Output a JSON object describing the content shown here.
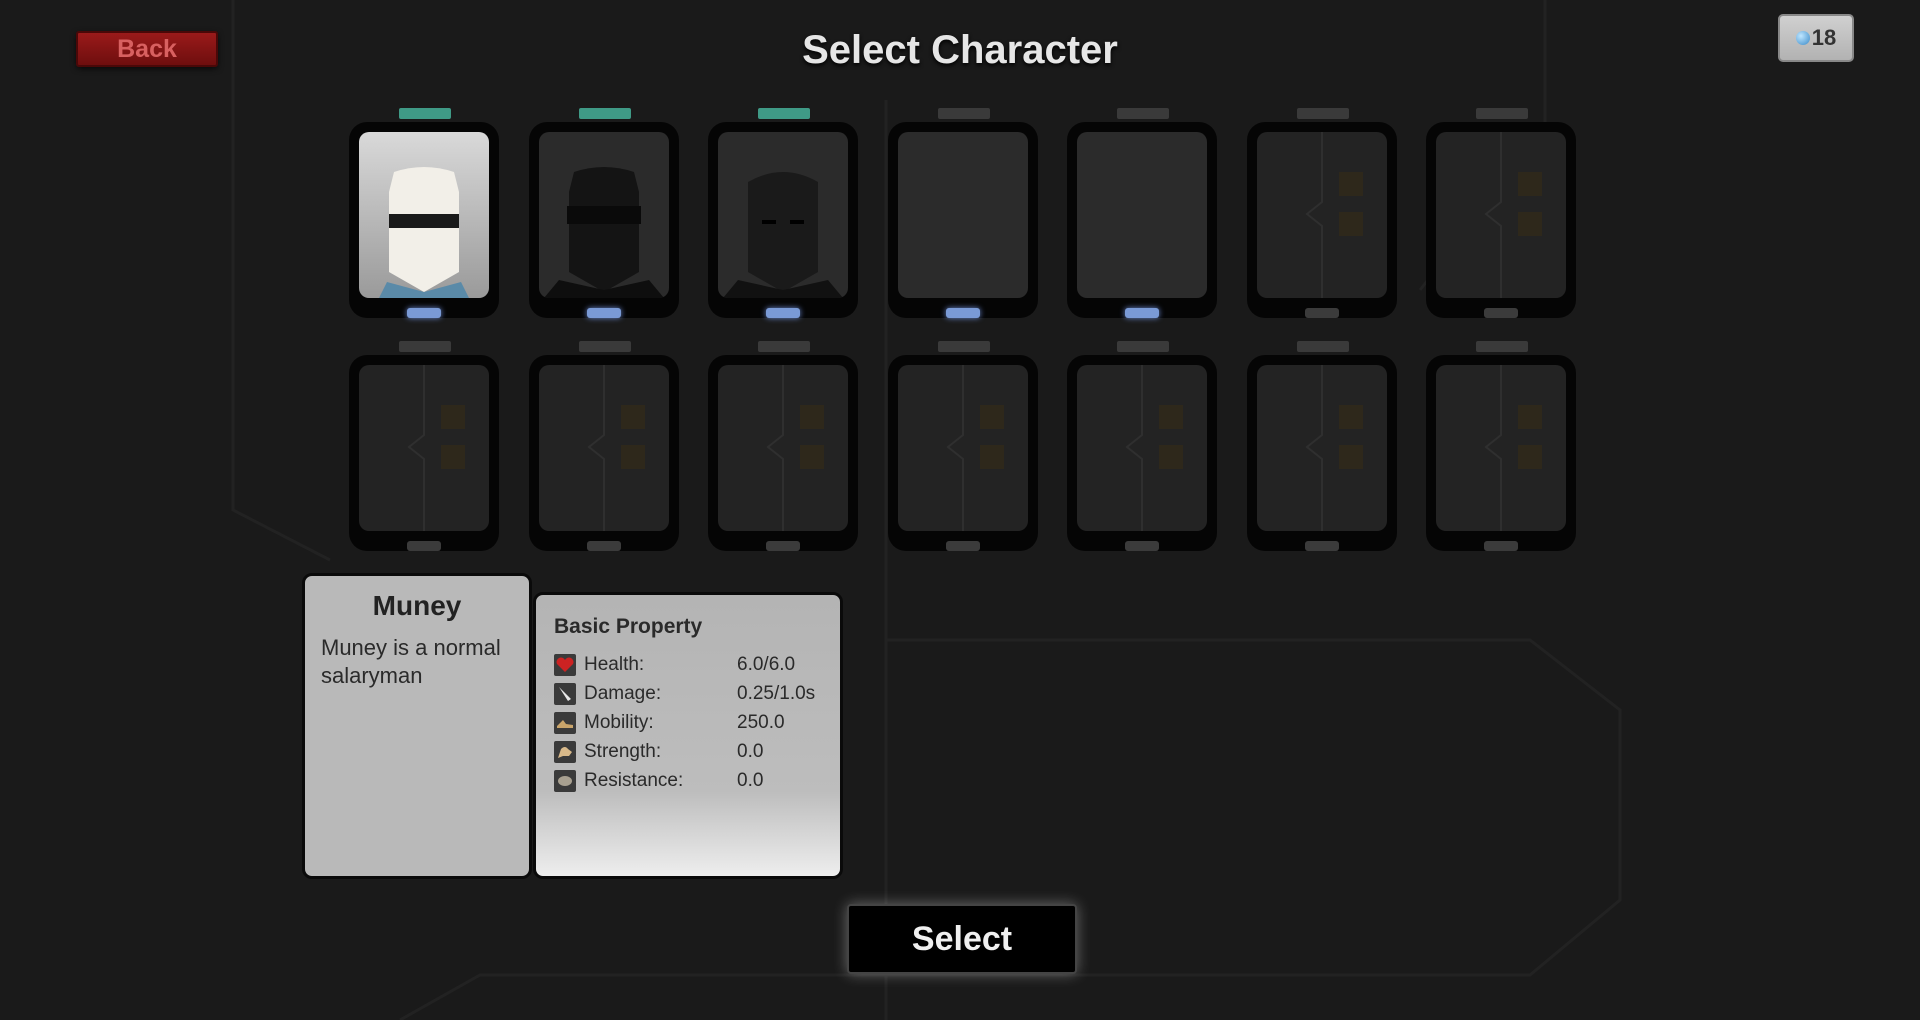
{
  "header": {
    "back_label": "Back",
    "title": "Select Character",
    "currency_value": "18",
    "currency_icon": "gem-icon"
  },
  "slots": [
    {
      "state": "selected",
      "unlocked": true,
      "active": true,
      "portrait": "light"
    },
    {
      "state": "owned",
      "unlocked": true,
      "active": true,
      "portrait": "dark-cap"
    },
    {
      "state": "owned",
      "unlocked": true,
      "active": true,
      "portrait": "dark-bald"
    },
    {
      "state": "empty",
      "unlocked": false,
      "active": true,
      "portrait": "none"
    },
    {
      "state": "empty",
      "unlocked": false,
      "active": true,
      "portrait": "none"
    },
    {
      "state": "locked",
      "unlocked": false,
      "active": false,
      "portrait": "none"
    },
    {
      "state": "locked",
      "unlocked": false,
      "active": false,
      "portrait": "none"
    },
    {
      "state": "locked",
      "unlocked": false,
      "active": false,
      "portrait": "none"
    },
    {
      "state": "locked",
      "unlocked": false,
      "active": false,
      "portrait": "none"
    },
    {
      "state": "locked",
      "unlocked": false,
      "active": false,
      "portrait": "none"
    },
    {
      "state": "locked",
      "unlocked": false,
      "active": false,
      "portrait": "none"
    },
    {
      "state": "locked",
      "unlocked": false,
      "active": false,
      "portrait": "none"
    },
    {
      "state": "locked",
      "unlocked": false,
      "active": false,
      "portrait": "none"
    },
    {
      "state": "locked",
      "unlocked": false,
      "active": false,
      "portrait": "none"
    }
  ],
  "character": {
    "name": "Muney",
    "description": "Muney is a normal salaryman"
  },
  "properties": {
    "title": "Basic Property",
    "rows": [
      {
        "label": "Health:",
        "value": "6.0/6.0",
        "icon": "heart-icon"
      },
      {
        "label": "Damage:",
        "value": "0.25/1.0s",
        "icon": "blade-icon"
      },
      {
        "label": "Mobility:",
        "value": "250.0",
        "icon": "shoe-icon"
      },
      {
        "label": "Strength:",
        "value": "0.0",
        "icon": "arm-icon"
      },
      {
        "label": "Resistance:",
        "value": "0.0",
        "icon": "shield-icon"
      }
    ]
  },
  "select_label": "Select",
  "colors": {
    "unlocked_bar": "#3f9a86",
    "active_dot": "#7a9ad6",
    "back_button": "#8a1414"
  }
}
